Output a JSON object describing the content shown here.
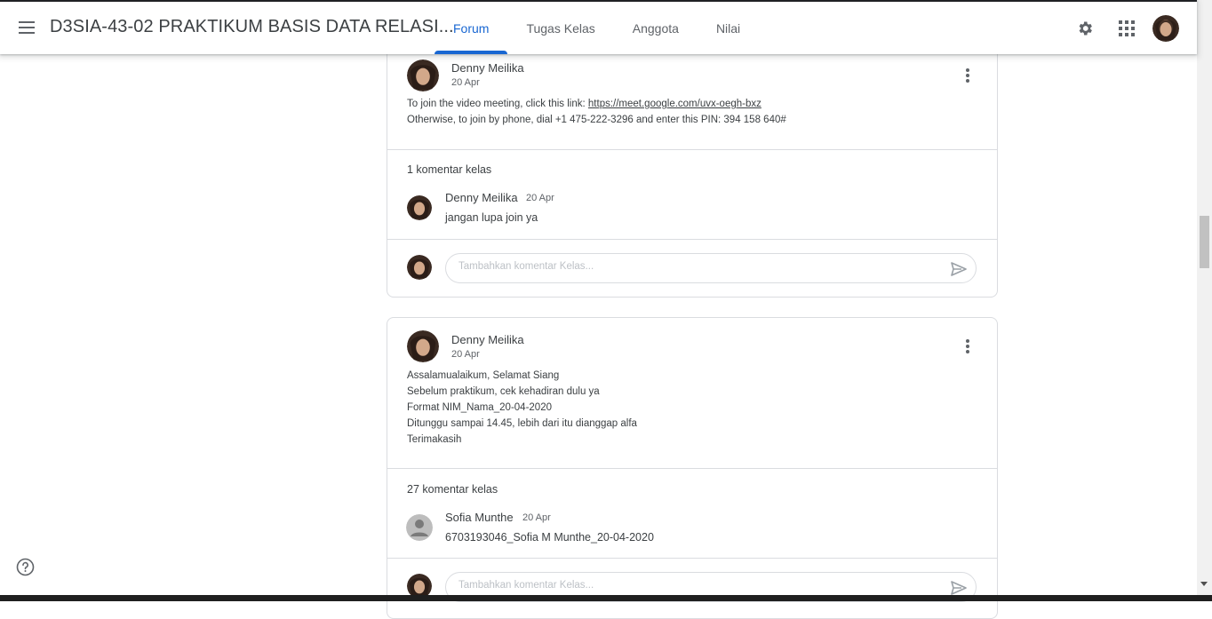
{
  "header": {
    "class_title": "D3SIA-43-02 PRAKTIKUM BASIS DATA RELASI...",
    "tabs": [
      {
        "label": "Forum",
        "active": true
      },
      {
        "label": "Tugas Kelas",
        "active": false
      },
      {
        "label": "Anggota",
        "active": false
      },
      {
        "label": "Nilai",
        "active": false
      }
    ],
    "icons": [
      "menu-icon",
      "gear-icon",
      "apps-grid-icon",
      "account-avatar"
    ]
  },
  "posts": [
    {
      "author": "Denny Meilika",
      "date": "20 Apr",
      "body": {
        "line1_prefix": "To join the video meeting, click this link: ",
        "link": "https://meet.google.com/uvx-oegh-bxz",
        "line2": "Otherwise, to join by phone, dial +1 475-222-3296 and enter this PIN: 394 158 640#"
      },
      "comments_count": "1 komentar kelas",
      "comment": {
        "author": "Denny Meilika",
        "date": "20 Apr",
        "text": "jangan lupa join ya"
      },
      "comment_placeholder": "Tambahkan komentar Kelas..."
    },
    {
      "author": "Denny Meilika",
      "date": "20 Apr",
      "lines": [
        "Assalamualaikum, Selamat Siang",
        "Sebelum praktikum, cek kehadiran dulu ya",
        "Format NIM_Nama_20-04-2020",
        "Ditunggu sampai 14.45, lebih dari itu dianggap alfa",
        "Terimakasih"
      ],
      "comments_count": "27 komentar kelas",
      "comment": {
        "author": "Sofia Munthe",
        "date": "20 Apr",
        "text": "6703193046_Sofia M Munthe_20-04-2020"
      },
      "comment_placeholder": "Tambahkan komentar Kelas..."
    }
  ],
  "colors": {
    "accent": "#1967d2",
    "border": "#dadce0",
    "text": "#3c4043",
    "muted": "#5f6368"
  }
}
